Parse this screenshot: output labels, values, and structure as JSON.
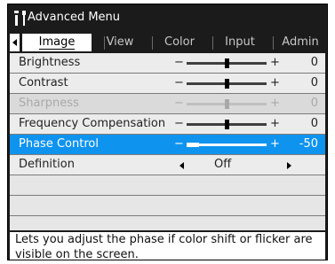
{
  "window": {
    "title": "Advanced Menu",
    "title_icon": "wrench-screwdriver-icon"
  },
  "tabs": [
    {
      "label": "Image",
      "active": true
    },
    {
      "label": "View"
    },
    {
      "label": "Color"
    },
    {
      "label": "Input"
    },
    {
      "label": "Admin"
    }
  ],
  "rows": {
    "brightness": {
      "label": "Brightness",
      "minus": "−",
      "plus": "+",
      "value": "0",
      "level": 0.5
    },
    "contrast": {
      "label": "Contrast",
      "minus": "−",
      "plus": "+",
      "value": "0",
      "level": 0.5
    },
    "sharpness": {
      "label": "Sharpness",
      "minus": "−",
      "plus": "+",
      "value": "0",
      "level": 0.5,
      "disabled": true
    },
    "frequency": {
      "label": "Frequency Compensation",
      "minus": "−",
      "plus": "+",
      "value": "0",
      "level": 0.5
    },
    "phase": {
      "label": "Phase Control",
      "minus": "−",
      "plus": "+",
      "value": "-50",
      "level": 0.0,
      "selected": true
    },
    "definition": {
      "label": "Definition",
      "value": "Off"
    }
  },
  "help_text": "Lets you adjust the phase if color shift or flicker are visible on the screen.",
  "colors": {
    "selection": "#0e93ef",
    "title_bar": "#1b1b1b",
    "panel": "#ececec"
  }
}
